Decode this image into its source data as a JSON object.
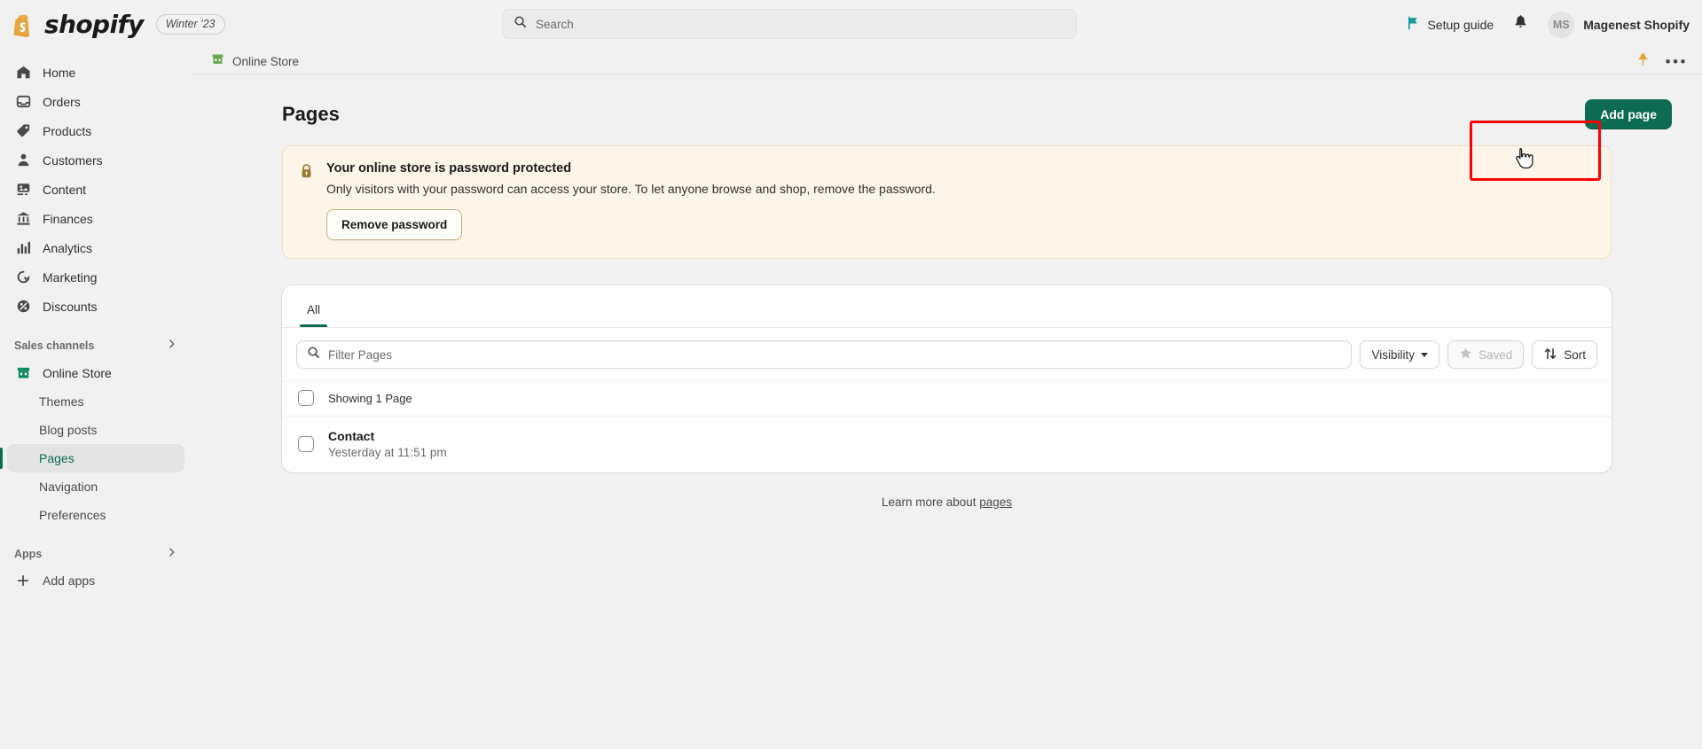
{
  "topbar": {
    "wordmark": "shopify",
    "season_badge": "Winter '23",
    "search_placeholder": "Search",
    "setup_guide": "Setup guide",
    "avatar_initials": "MS",
    "store_name": "Magenest Shopify"
  },
  "sidebar": {
    "items": [
      {
        "label": "Home",
        "icon": "home-icon"
      },
      {
        "label": "Orders",
        "icon": "orders-icon"
      },
      {
        "label": "Products",
        "icon": "products-tag-icon"
      },
      {
        "label": "Customers",
        "icon": "customers-person-icon"
      },
      {
        "label": "Content",
        "icon": "content-image-icon"
      },
      {
        "label": "Finances",
        "icon": "finances-bank-icon"
      },
      {
        "label": "Analytics",
        "icon": "analytics-bars-icon"
      },
      {
        "label": "Marketing",
        "icon": "marketing-target-icon"
      },
      {
        "label": "Discounts",
        "icon": "discounts-percent-icon"
      }
    ],
    "sales_channels_label": "Sales channels",
    "online_store": "Online Store",
    "sub_items": [
      {
        "label": "Themes",
        "active": false
      },
      {
        "label": "Blog posts",
        "active": false
      },
      {
        "label": "Pages",
        "active": true
      },
      {
        "label": "Navigation",
        "active": false
      },
      {
        "label": "Preferences",
        "active": false
      }
    ],
    "apps_label": "Apps",
    "add_apps_label": "Add apps"
  },
  "context_bar": {
    "title": "Online Store",
    "pin_icon": "pushpin-icon",
    "more_icon": "more-horizontal-icon"
  },
  "page": {
    "title": "Pages",
    "add_page_button": "Add page"
  },
  "banner": {
    "icon": "lock-icon",
    "title": "Your online store is password protected",
    "text": "Only visitors with your password can access your store. To let anyone browse and shop, remove the password.",
    "action_label": "Remove password"
  },
  "card": {
    "tabs": [
      {
        "label": "All",
        "active": true
      }
    ],
    "filter_placeholder": "Filter Pages",
    "visibility_label": "Visibility",
    "saved_label": "Saved",
    "sort_label": "Sort",
    "list_header": "Showing 1 Page",
    "rows": [
      {
        "title": "Contact",
        "subtitle": "Yesterday at 11:51 pm"
      }
    ]
  },
  "footer": {
    "text": "Learn more about ",
    "link": "pages"
  },
  "colors": {
    "brand_green": "#0c6b52",
    "shopify_bag": "#e8a33d",
    "banner_bg": "#fdf5ea",
    "highlight_red": "#ff0000",
    "teal_flag": "#159b9b"
  }
}
